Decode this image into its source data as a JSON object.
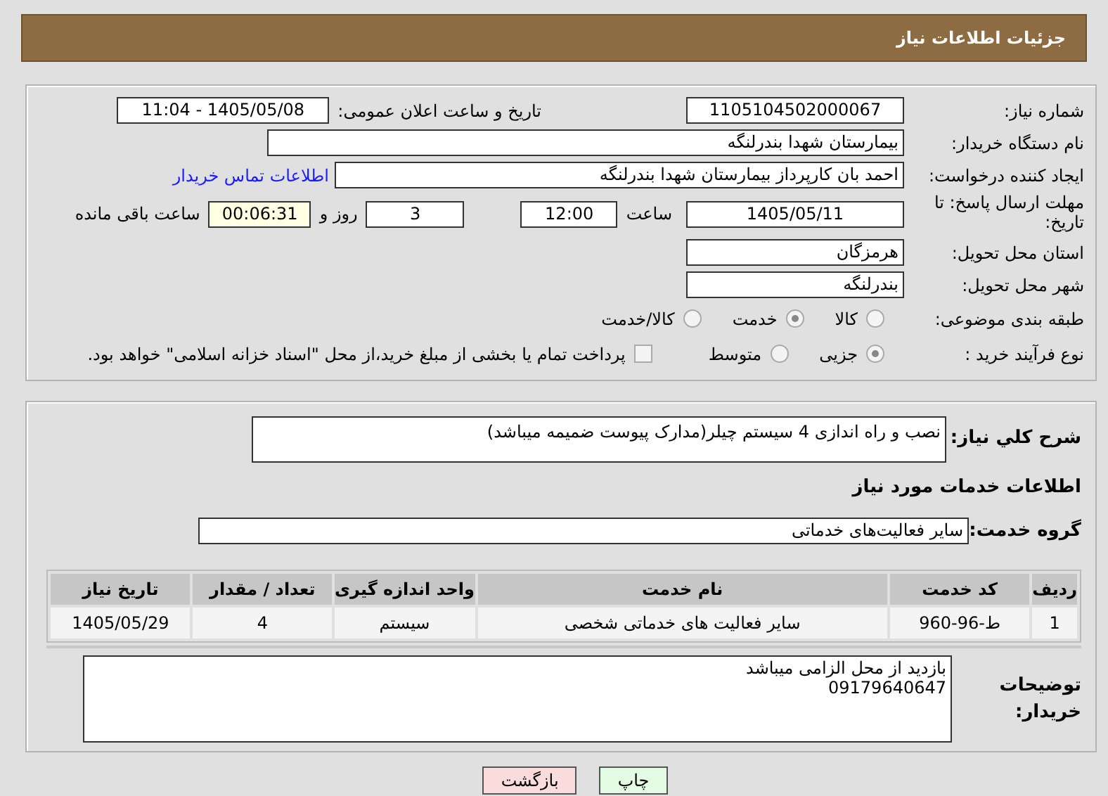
{
  "header": {
    "title": "جزئیات اطلاعات نیاز"
  },
  "details": {
    "need_number": {
      "label": "شماره نیاز:",
      "value": "1105104502000067"
    },
    "announce_datetime": {
      "label": "تاریخ و ساعت اعلان عمومی:",
      "value": "1405/05/08 - 11:04"
    },
    "buyer_org": {
      "label": "نام دستگاه خریدار:",
      "value": "بیمارستان شهدا بندرلنگه"
    },
    "requester": {
      "label": "ایجاد کننده درخواست:",
      "value": "احمد بان کارپرداز بیمارستان شهدا بندرلنگه",
      "link": "اطلاعات تماس خریدار"
    },
    "deadline": {
      "label": "مهلت ارسال پاسخ: تا تاریخ:",
      "date": "1405/05/11",
      "time_label": "ساعت",
      "time": "12:00",
      "days": "3",
      "days_label": "روز و",
      "remaining": "00:06:31",
      "remaining_label": "ساعت باقی مانده"
    },
    "province": {
      "label": "استان محل تحویل:",
      "value": "هرمزگان"
    },
    "city": {
      "label": "شهر محل تحویل:",
      "value": "بندرلنگه"
    },
    "category": {
      "label": "طبقه بندی موضوعی:",
      "options": [
        {
          "label": "کالا",
          "selected": false
        },
        {
          "label": "خدمت",
          "selected": true
        },
        {
          "label": "کالا/خدمت",
          "selected": false
        }
      ]
    },
    "process": {
      "label": "نوع فرآیند خرید :",
      "options": [
        {
          "label": "جزیی",
          "selected": true
        },
        {
          "label": "متوسط",
          "selected": false
        }
      ],
      "payment_note": {
        "checked": false,
        "text": "پرداخت تمام یا بخشی از مبلغ خرید،از محل \"اسناد خزانه اسلامی\" خواهد بود."
      }
    }
  },
  "summary": {
    "label": "شرح کلي نیاز:",
    "value": "نصب و راه اندازی 4 سیستم چیلر(مدارک پیوست ضمیمه میباشد)"
  },
  "services_heading": "اطلاعات خدمات مورد نیاز",
  "service_group": {
    "label": "گروه خدمت:",
    "value": "سایر فعالیت‌های خدماتی"
  },
  "table": {
    "columns": [
      "ردیف",
      "کد خدمت",
      "نام خدمت",
      "واحد اندازه گیری",
      "تعداد / مقدار",
      "تاریخ نیاز"
    ],
    "rows": [
      [
        "1",
        "ط-96-960",
        "سایر فعالیت های خدماتی شخصی",
        "سیستم",
        "4",
        "1405/05/29"
      ]
    ]
  },
  "buyer_notes": {
    "label": "توضیحات خریدار:",
    "lines": [
      "بازدید از محل الزامی میباشد",
      "09179640647"
    ]
  },
  "buttons": [
    {
      "label": "چاپ",
      "kind": "print"
    },
    {
      "label": "بازگشت",
      "kind": "back"
    }
  ]
}
